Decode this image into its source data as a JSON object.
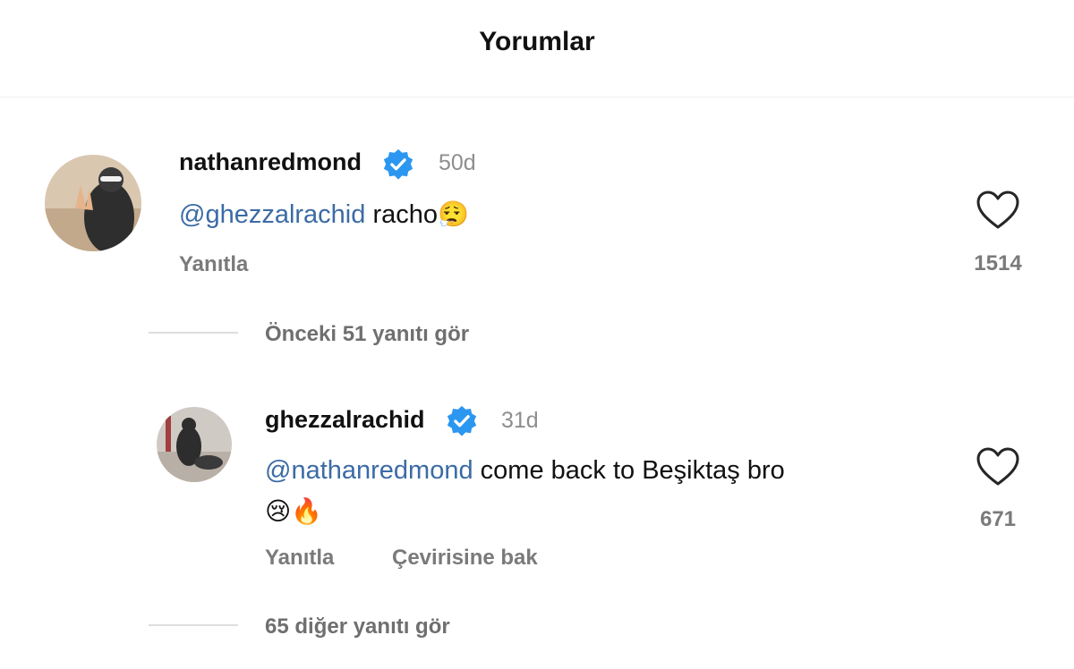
{
  "header": {
    "title": "Yorumlar"
  },
  "comments": [
    {
      "username": "nathanredmond",
      "time": "50d",
      "mention": "@ghezzalrachid",
      "text": " racho",
      "emoji": "😮‍💨",
      "reply_label": "Yanıtla",
      "likes": "1514",
      "icons": {
        "verified": "verified-badge-icon",
        "like": "heart-outline-icon"
      }
    },
    {
      "username": "ghezzalrachid",
      "time": "31d",
      "mention": "@nathanredmond",
      "text": " come back to Beşiktaş bro",
      "emoji": "😢🔥",
      "reply_label": "Yanıtla",
      "translate_label": "Çevirisine bak",
      "likes": "671",
      "icons": {
        "verified": "verified-badge-icon",
        "like": "heart-outline-icon"
      }
    }
  ],
  "view_previous": "Önceki 51 yanıtı gör",
  "view_more": "65 diğer yanıtı gör",
  "colors": {
    "mention": "#3b6ba5",
    "verified": "#2c97f0",
    "muted": "#8e8e8e"
  }
}
